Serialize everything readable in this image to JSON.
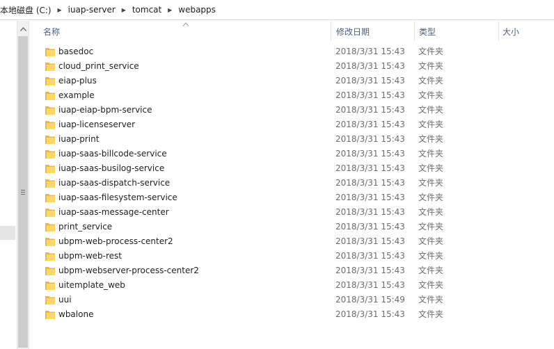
{
  "breadcrumb": {
    "items": [
      "本地磁盘 (C:)",
      "iuap-server",
      "tomcat",
      "webapps"
    ]
  },
  "columns": {
    "name": "名称",
    "modified": "修改日期",
    "type": "类型",
    "size": "大小"
  },
  "files": [
    {
      "name": "basedoc",
      "modified": "2018/3/31 15:43",
      "type": "文件夹"
    },
    {
      "name": "cloud_print_service",
      "modified": "2018/3/31 15:43",
      "type": "文件夹"
    },
    {
      "name": "eiap-plus",
      "modified": "2018/3/31 15:43",
      "type": "文件夹"
    },
    {
      "name": "example",
      "modified": "2018/3/31 15:43",
      "type": "文件夹"
    },
    {
      "name": "iuap-eiap-bpm-service",
      "modified": "2018/3/31 15:43",
      "type": "文件夹"
    },
    {
      "name": "iuap-licenseserver",
      "modified": "2018/3/31 15:43",
      "type": "文件夹"
    },
    {
      "name": "iuap-print",
      "modified": "2018/3/31 15:43",
      "type": "文件夹"
    },
    {
      "name": "iuap-saas-billcode-service",
      "modified": "2018/3/31 15:43",
      "type": "文件夹"
    },
    {
      "name": "iuap-saas-busilog-service",
      "modified": "2018/3/31 15:43",
      "type": "文件夹"
    },
    {
      "name": "iuap-saas-dispatch-service",
      "modified": "2018/3/31 15:43",
      "type": "文件夹"
    },
    {
      "name": "iuap-saas-filesystem-service",
      "modified": "2018/3/31 15:43",
      "type": "文件夹"
    },
    {
      "name": "iuap-saas-message-center",
      "modified": "2018/3/31 15:43",
      "type": "文件夹"
    },
    {
      "name": "print_service",
      "modified": "2018/3/31 15:43",
      "type": "文件夹"
    },
    {
      "name": "ubpm-web-process-center2",
      "modified": "2018/3/31 15:43",
      "type": "文件夹"
    },
    {
      "name": "ubpm-web-rest",
      "modified": "2018/3/31 15:43",
      "type": "文件夹"
    },
    {
      "name": "ubpm-webserver-process-center2",
      "modified": "2018/3/31 15:43",
      "type": "文件夹"
    },
    {
      "name": "uitemplate_web",
      "modified": "2018/3/31 15:43",
      "type": "文件夹"
    },
    {
      "name": "uui",
      "modified": "2018/3/31 15:49",
      "type": "文件夹"
    },
    {
      "name": "wbalone",
      "modified": "2018/3/31 15:43",
      "type": "文件夹"
    }
  ],
  "icons": {
    "folder": "folder-icon",
    "breadcrumb_separator": "chevron-right-icon",
    "sort": "sort-ascending-icon",
    "scroll_up": "scroll-up-arrow-icon",
    "scroll_grip": "scroll-grip-icon"
  },
  "colors": {
    "header_text": "#4c607a",
    "meta_text": "#6d6d6d",
    "folder_yellow": "#ffd766",
    "folder_dark": "#e8b848"
  }
}
